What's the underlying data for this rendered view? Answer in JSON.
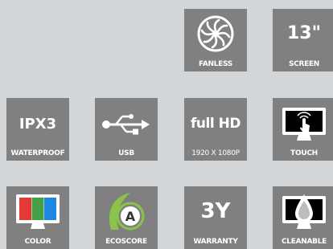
{
  "tiles": {
    "fanless": {
      "label": "FANLESS",
      "icon": "fan-icon"
    },
    "screen": {
      "value": "13\"",
      "label": "SCREEN"
    },
    "waterproof": {
      "value": "IPX3",
      "label": "WATERPROOF"
    },
    "usb": {
      "label": "USB",
      "icon": "usb-icon"
    },
    "resolution": {
      "value": "full HD",
      "label": "1920 X 1080P"
    },
    "touch": {
      "label": "TOUCH",
      "icon": "touch-screen-icon"
    },
    "color": {
      "label": "COLOR",
      "icon": "color-monitor-icon"
    },
    "ecoscore": {
      "label": "ECOSCORE",
      "icon": "eco-leaf-icon",
      "letter": "A"
    },
    "warranty": {
      "value": "3Y",
      "label": "WARRANTY"
    },
    "cleanable": {
      "label": "CLEANABLE",
      "icon": "water-drop-monitor-icon"
    }
  },
  "colors": {
    "background": "#d2d6d8",
    "tile": "#808080",
    "text": "#ffffff",
    "eco_green": "#8bc34a",
    "monitor_red": "#e53935",
    "monitor_green": "#43a047",
    "monitor_blue": "#1e88e5"
  }
}
